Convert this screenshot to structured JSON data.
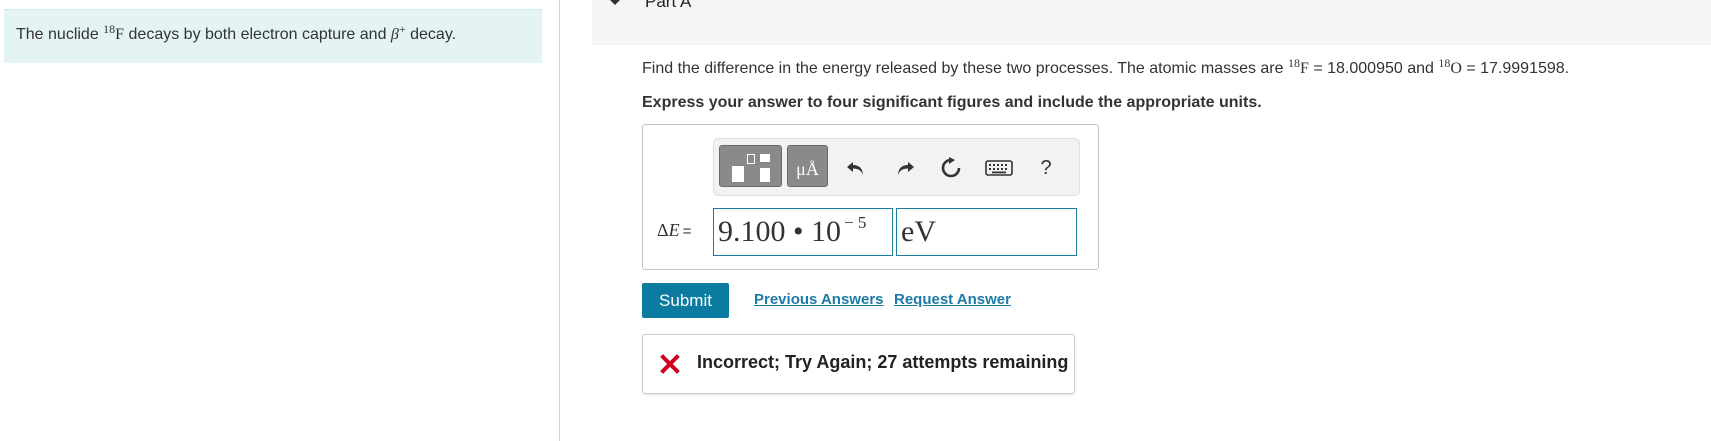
{
  "intro": {
    "prefix": "The nuclide ",
    "nuclide_mass": "18",
    "nuclide_symbol": "F",
    "middle": " decays by both electron capture and ",
    "beta": "β",
    "beta_sign": "+",
    "suffix": " decay."
  },
  "part": {
    "title": "Part A"
  },
  "question": {
    "text_start": "Find the difference in the energy released by these two processes. The atomic masses are ",
    "f_mass": "18",
    "f_symbol": "F",
    "f_value": " = 18.000950 and ",
    "o_mass": "18",
    "o_symbol": "O",
    "o_value": " = 17.9991598."
  },
  "instruction": "Express your answer to four significant figures and include the appropriate units.",
  "toolbar": {
    "units_label": "μÅ",
    "help_label": "?",
    "icons": [
      "templates-icon",
      "units-icon",
      "undo-icon",
      "redo-icon",
      "reset-icon",
      "keyboard-icon",
      "help-icon"
    ]
  },
  "answer": {
    "variable": "ΔE",
    "equals": "=",
    "value_mantissa": "9.100 • 10",
    "value_exponent": "− 5",
    "unit": "eV"
  },
  "actions": {
    "submit_label": "Submit",
    "previous_answers_label": "Previous Answers",
    "request_answer_label": "Request Answer"
  },
  "feedback": {
    "text": "Incorrect; Try Again; 27 attempts remaining",
    "status": "incorrect"
  },
  "colors": {
    "intro_bg": "#e4f4f5",
    "accent": "#0b7ba0",
    "link": "#1d7aa8",
    "error": "#d0021b"
  }
}
